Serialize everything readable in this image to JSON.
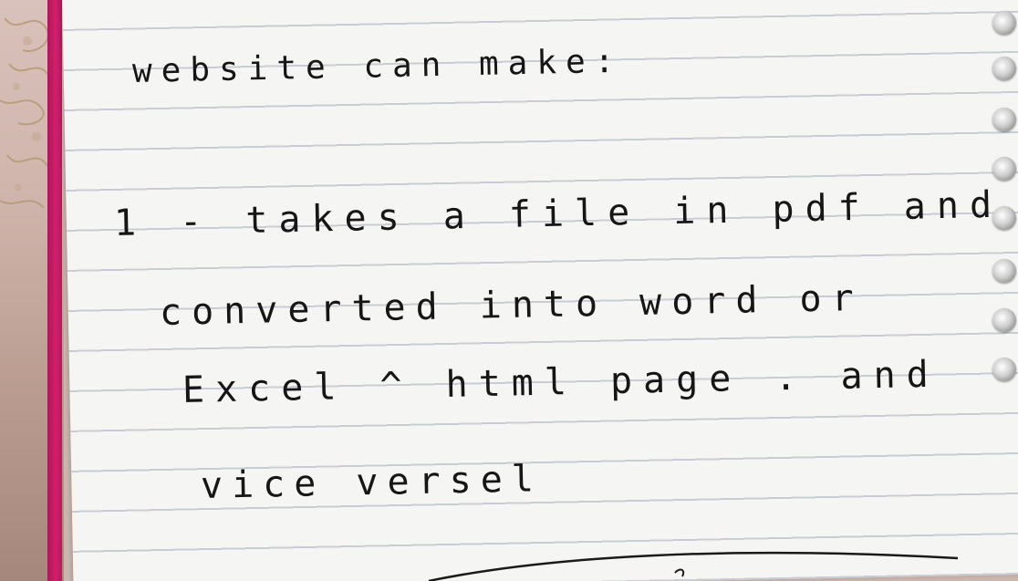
{
  "note": {
    "lines": [
      "website   can make:",
      "1 - takes  a file  in pdf and",
      "converted into  word or",
      "Excel  ^ html page . and",
      "vice versel"
    ]
  },
  "colors": {
    "paper": "#f5f5f3",
    "rule_line": "#c9cdd3",
    "notebook_edge": "#d21f6b",
    "ink": "#161616",
    "fabric": "#cfb4ab"
  }
}
